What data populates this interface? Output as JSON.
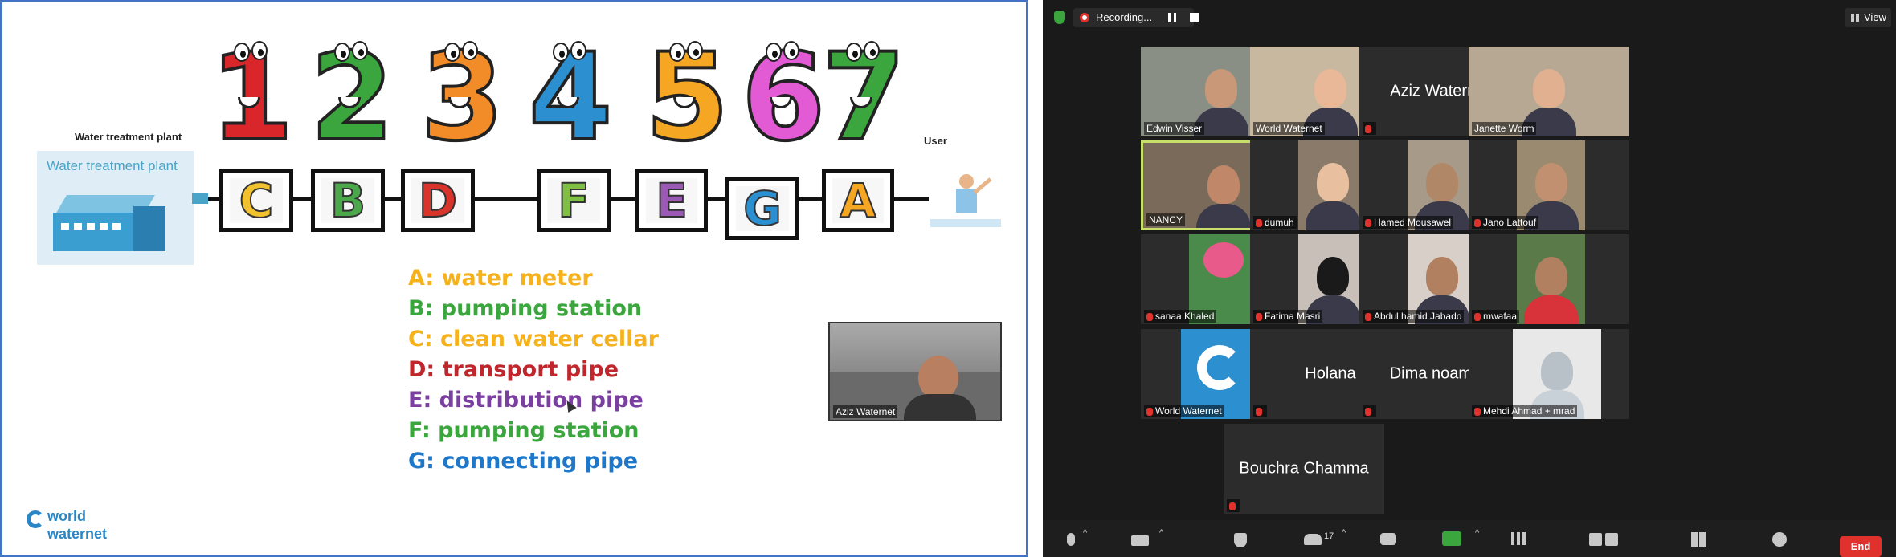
{
  "slide": {
    "plant_label": "Water treatment plant",
    "plant_image_label": "Water treatment plant",
    "user_label": "User",
    "numbers": [
      "1",
      "2",
      "3",
      "4",
      "5",
      "6",
      "7"
    ],
    "number_colors": [
      "#d9262b",
      "#3aa63d",
      "#f28c28",
      "#2b8fd0",
      "#f5a623",
      "#e25bd4",
      "#3aa63d"
    ],
    "boxes": [
      {
        "letter": "C",
        "color": "#f2c12e"
      },
      {
        "letter": "B",
        "color": "#4aa84a"
      },
      {
        "letter": "D",
        "color": "#d9342b"
      },
      {
        "letter": "F",
        "color": "#7fc043"
      },
      {
        "letter": "E",
        "color": "#9b59b6"
      },
      {
        "letter": "G",
        "color": "#2b8fd0"
      },
      {
        "letter": "A",
        "color": "#f5a623"
      }
    ],
    "legend": [
      {
        "text": "A: water meter",
        "color": "#f5b21d"
      },
      {
        "text": "B: pumping station",
        "color": "#3aa63d"
      },
      {
        "text": "C: clean water cellar",
        "color": "#f5b21d"
      },
      {
        "text": "D: transport pipe",
        "color": "#c0272d"
      },
      {
        "text": "E: distribution pipe",
        "color": "#7b3fa0"
      },
      {
        "text": "F: pumping station",
        "color": "#3aa63d"
      },
      {
        "text": "G: connecting pipe",
        "color": "#1f77c9"
      }
    ],
    "presenter_name": "Aziz Waternet",
    "logo_line1": "world",
    "logo_line2": "waternet"
  },
  "zoom": {
    "recording_label": "Recording...",
    "view_label": "View",
    "participants": [
      {
        "name": "Edwin Visser",
        "video": true,
        "muted": false
      },
      {
        "name": "World Waternet",
        "video": true,
        "muted": false
      },
      {
        "name": "Aziz Waternet",
        "video": false,
        "muted": true
      },
      {
        "name": "Janette Worm",
        "video": true,
        "muted": false
      },
      {
        "name": "NANCY",
        "video": true,
        "muted": false
      },
      {
        "name": "dumuh",
        "video": true,
        "muted": true
      },
      {
        "name": "Hamed Mousawel",
        "video": true,
        "muted": true
      },
      {
        "name": "Jano Lattouf",
        "video": true,
        "muted": true
      },
      {
        "name": "sanaa Khaled",
        "video": true,
        "muted": true
      },
      {
        "name": "Fatima Masri",
        "video": true,
        "muted": true
      },
      {
        "name": "Abdul hamid Jabado",
        "video": true,
        "muted": true
      },
      {
        "name": "mwafaa",
        "video": true,
        "muted": true
      },
      {
        "name": "World Waternet",
        "video": true,
        "muted": true
      },
      {
        "name": "Holana",
        "video": false,
        "muted": true
      },
      {
        "name": "Dima noaman",
        "video": false,
        "muted": true
      },
      {
        "name": "Mehdi Ahmad + mrad",
        "video": true,
        "muted": true
      },
      {
        "name": "Bouchra Chamma",
        "video": false,
        "muted": true
      }
    ],
    "participant_count": "17",
    "end_label": "End",
    "active_speaker_color": "#c8e06a",
    "end_color": "#e0322c"
  }
}
